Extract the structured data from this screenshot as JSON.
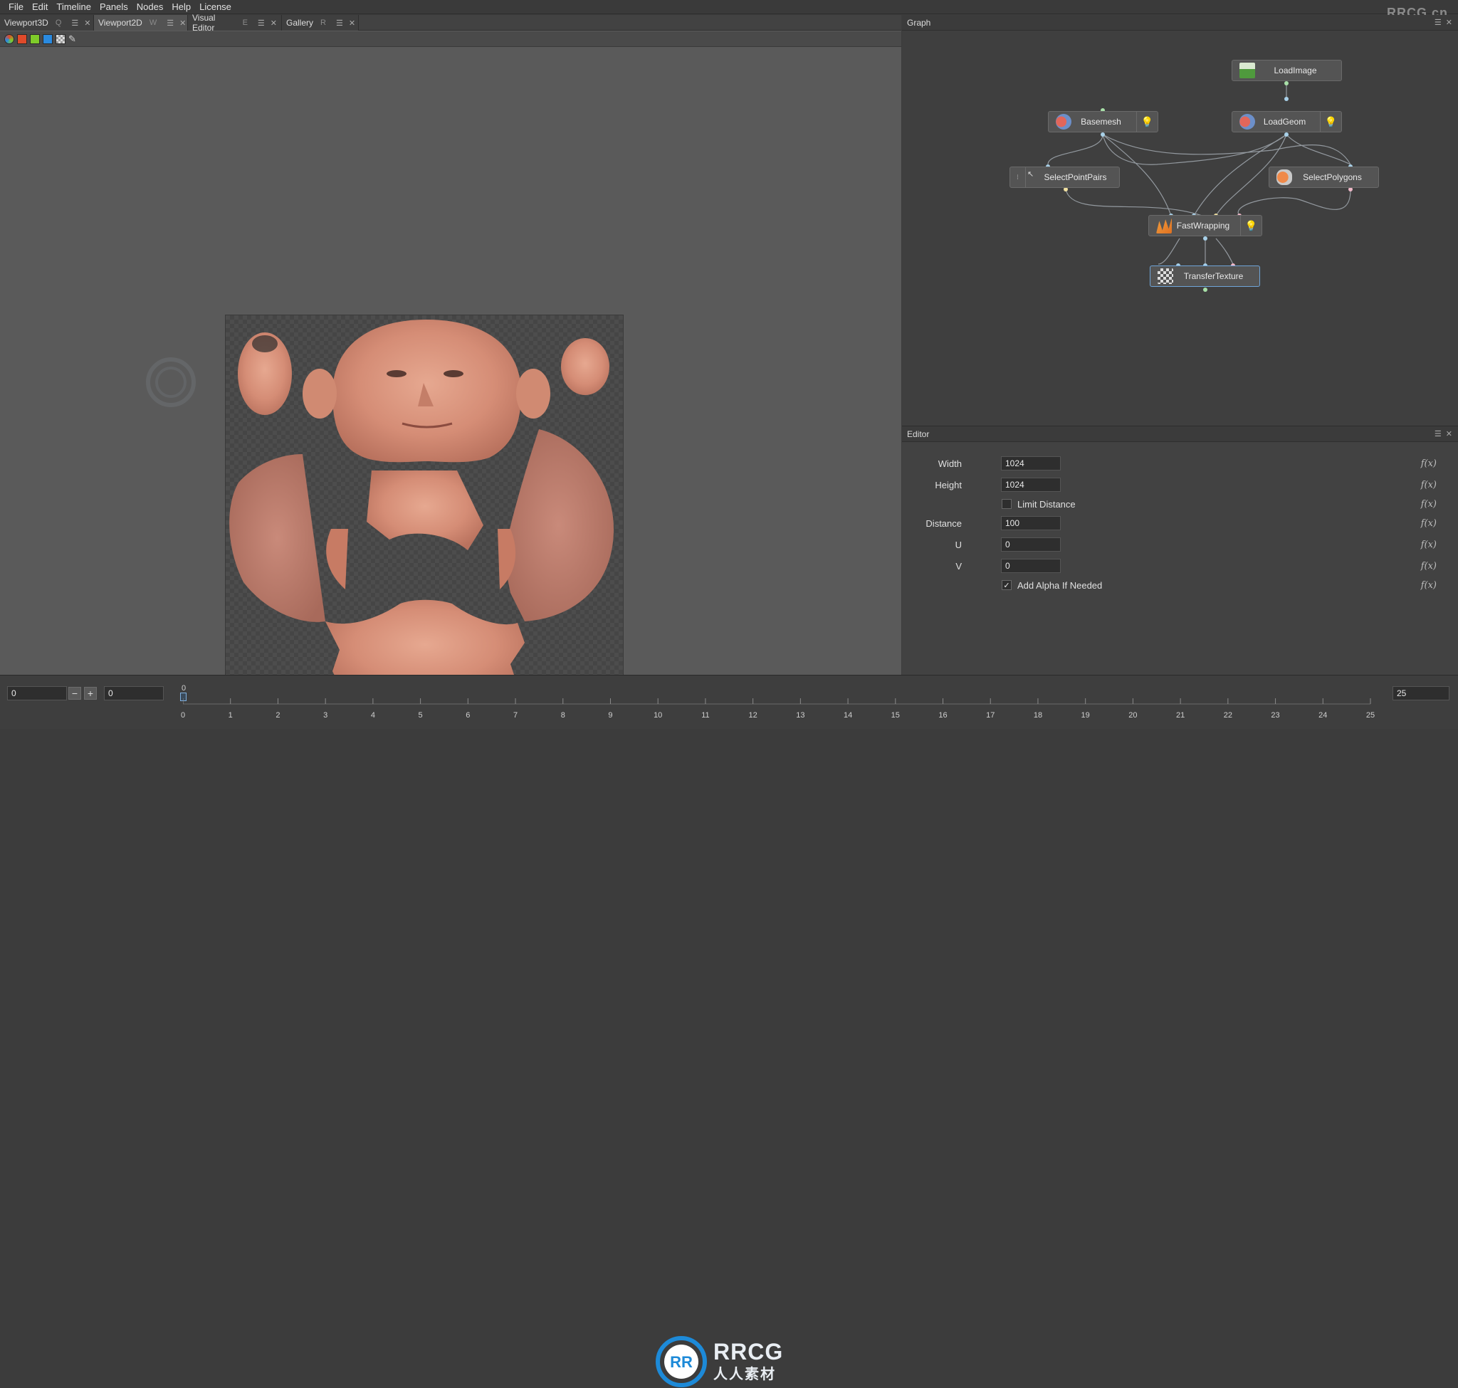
{
  "menu": [
    "File",
    "Edit",
    "Timeline",
    "Panels",
    "Nodes",
    "Help",
    "License"
  ],
  "watermark": "RRCG.cn",
  "tabs": [
    {
      "label": "Viewport3D",
      "shortcut": "Q"
    },
    {
      "label": "Viewport2D",
      "shortcut": "W"
    },
    {
      "label": "Visual Editor",
      "shortcut": "E"
    },
    {
      "label": "Gallery",
      "shortcut": "R"
    }
  ],
  "toolbar_colors": [
    "#e04a2a",
    "#7fcc2a",
    "#2a8ae0"
  ],
  "graph": {
    "title": "Graph",
    "nodes": {
      "load_image": "LoadImage",
      "basemesh": "Basemesh",
      "load_geom": "LoadGeom",
      "select_point_pairs": "SelectPointPairs",
      "select_polygons": "SelectPolygons",
      "fast_wrapping": "FastWrapping",
      "transfer_texture": "TransferTexture"
    }
  },
  "editor": {
    "title": "Editor",
    "width_label": "Width",
    "width_value": "1024",
    "height_label": "Height",
    "height_value": "1024",
    "limit_distance_label": "Limit Distance",
    "limit_distance_checked": false,
    "distance_label": "Distance",
    "distance_value": "100",
    "u_label": "U",
    "u_value": "0",
    "v_label": "V",
    "v_value": "0",
    "add_alpha_label": "Add Alpha If Needed",
    "add_alpha_checked": true,
    "fx_symbol": "f(x)"
  },
  "timeline": {
    "start_value": "0",
    "current_value": "0",
    "end_value": "25",
    "cursor_label": "0",
    "ticks": [
      "0",
      "1",
      "2",
      "3",
      "4",
      "5",
      "6",
      "7",
      "8",
      "9",
      "10",
      "11",
      "12",
      "13",
      "14",
      "15",
      "16",
      "17",
      "18",
      "19",
      "20",
      "21",
      "22",
      "23",
      "24",
      "25"
    ]
  },
  "bottom_watermark": {
    "brand": "RRCG",
    "sub": "人人素材"
  }
}
